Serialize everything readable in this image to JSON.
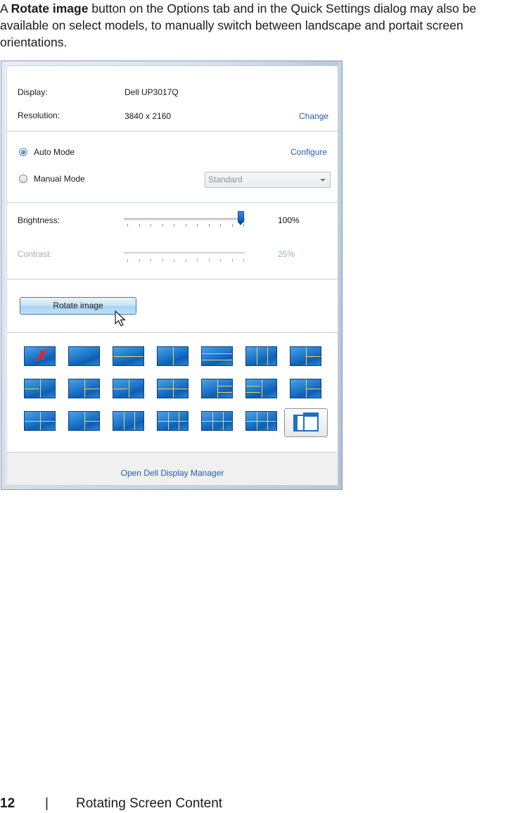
{
  "intro": {
    "bold": "Rotate image",
    "text": " button on the Options tab and in the Quick Settings dialog may also be available on select models, to manually switch between landscape and portait screen orientations.",
    "prefix": "A "
  },
  "dialog": {
    "display_label": "Display:",
    "display_value": "Dell UP3017Q",
    "resolution_label": "Resolution:",
    "resolution_value": "3840 x 2160",
    "change_link": "Change",
    "auto_mode_label": "Auto Mode",
    "configure_link": "Configure",
    "manual_mode_label": "Manual Mode",
    "preset_select_value": "Standard",
    "brightness_label": "Brightness:",
    "brightness_value": "100%",
    "brightness_level": 100,
    "contrast_label": "Contrast:",
    "contrast_value": "25%",
    "contrast_level": 25,
    "rotate_button": "Rotate image",
    "footer_link": "Open Dell Display Manager"
  },
  "layout_presets": {
    "selected_index": 20,
    "rows": 3,
    "per_row": 7
  },
  "page_footer": {
    "number": "12",
    "separator": "|",
    "title": "Rotating Screen Content"
  },
  "colors": {
    "link": "#1e5fb4",
    "tile": "#1f79cc",
    "slider_thumb": "#0d56b8"
  }
}
